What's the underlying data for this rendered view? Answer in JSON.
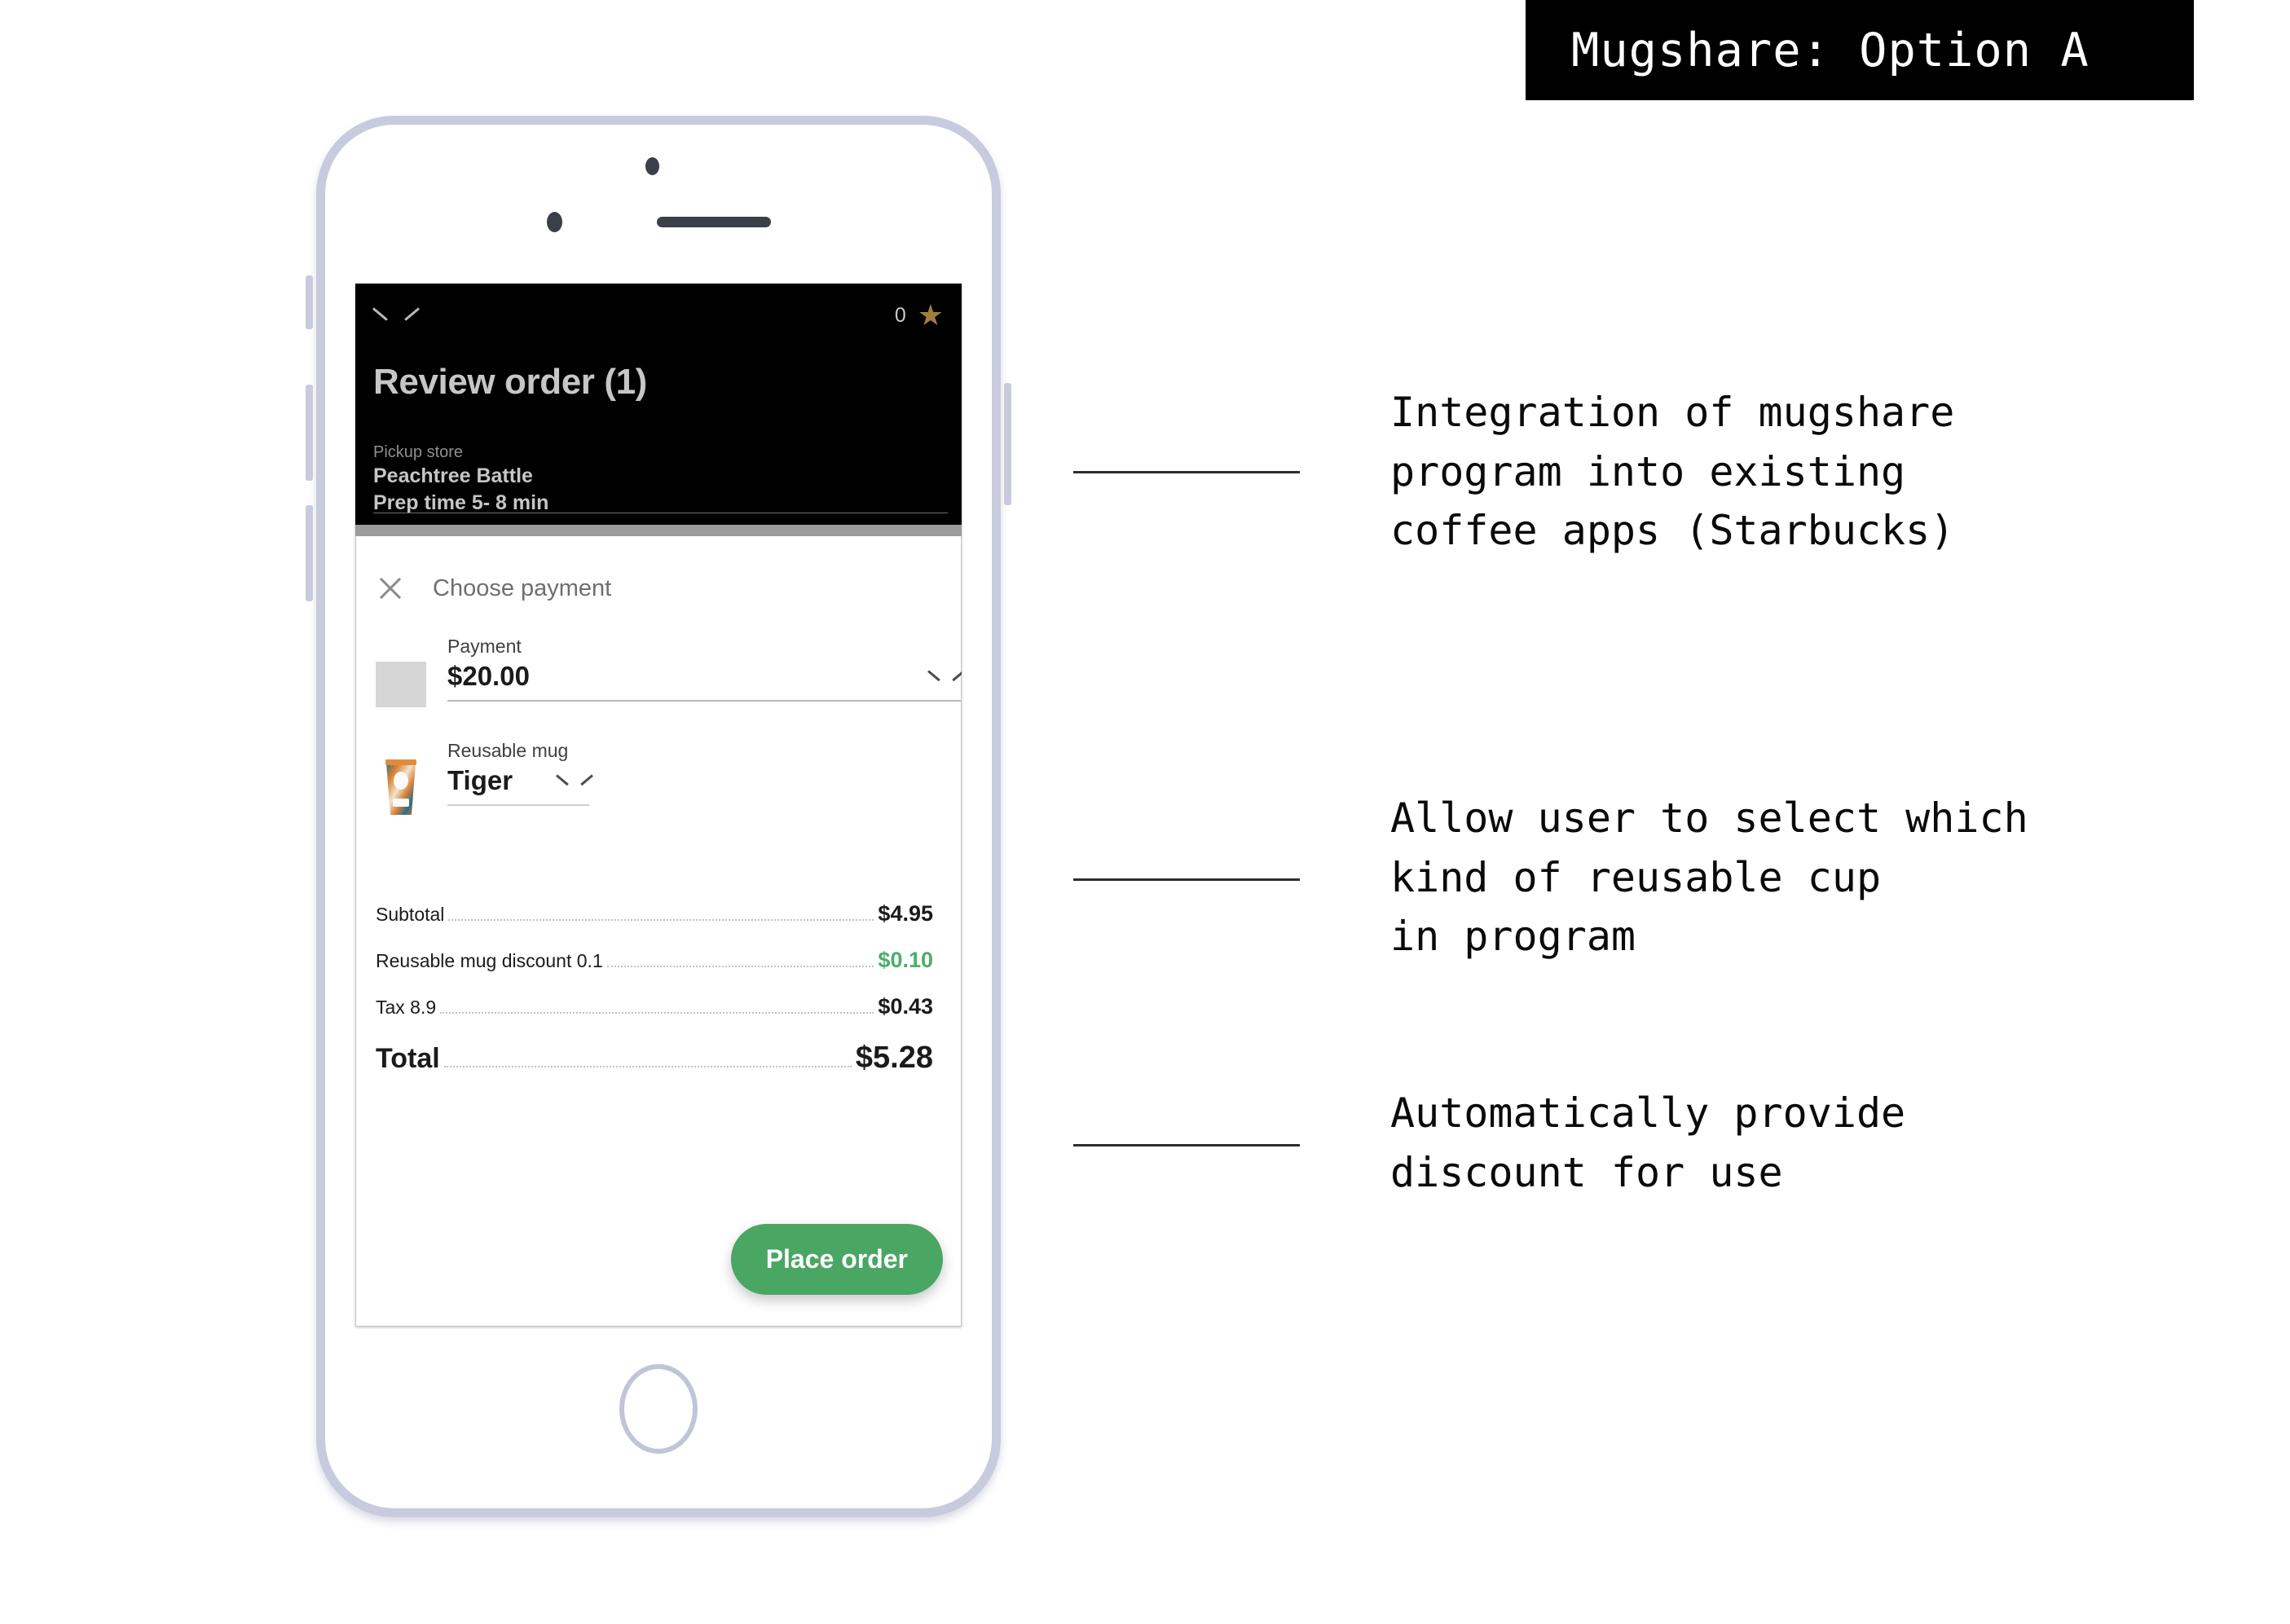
{
  "title_banner": {
    "text": "Mugshare: Option A"
  },
  "phone_app": {
    "header": {
      "collapse_icon": "chevron-down-icon",
      "star_count": "0",
      "star_icon": "star-icon",
      "title": "Review order (1)",
      "pickup_label": "Pickup store",
      "pickup_store": "Peachtree Battle",
      "prep_time": "Prep time 5- 8 min"
    },
    "payment_panel": {
      "close_icon": "close-icon",
      "heading": "Choose payment",
      "payment_field": {
        "label": "Payment",
        "value": "$20.00",
        "dropdown_icon": "chevron-down-icon"
      },
      "mug_field": {
        "label": "Reusable mug",
        "value": "Tiger",
        "dropdown_icon": "chevron-down-icon",
        "thumbnail": "reusable-mug-thumbnail"
      },
      "totals": [
        {
          "label": "Subtotal",
          "value": "$4.95",
          "kind": "normal"
        },
        {
          "label": "Reusable mug discount 0.1",
          "value": "$0.10",
          "kind": "discount"
        },
        {
          "label": "Tax 8.9",
          "value": "$0.43",
          "kind": "normal"
        },
        {
          "label": "Total",
          "value": "$5.28",
          "kind": "grand"
        }
      ],
      "place_order_label": "Place order"
    }
  },
  "annotations": [
    {
      "text": "Integration of mugshare\nprogram into existing\ncoffee apps (Starbucks)"
    },
    {
      "text": "Allow user to select which\nkind of reusable cup\nin program"
    },
    {
      "text": "Automatically provide\ndiscount for use"
    }
  ],
  "colors": {
    "discount_green": "#4aae6a",
    "button_green": "#4aa663",
    "star_gold": "#a07f3d",
    "bezel": "#c7cbdd",
    "header_black": "#000000"
  }
}
